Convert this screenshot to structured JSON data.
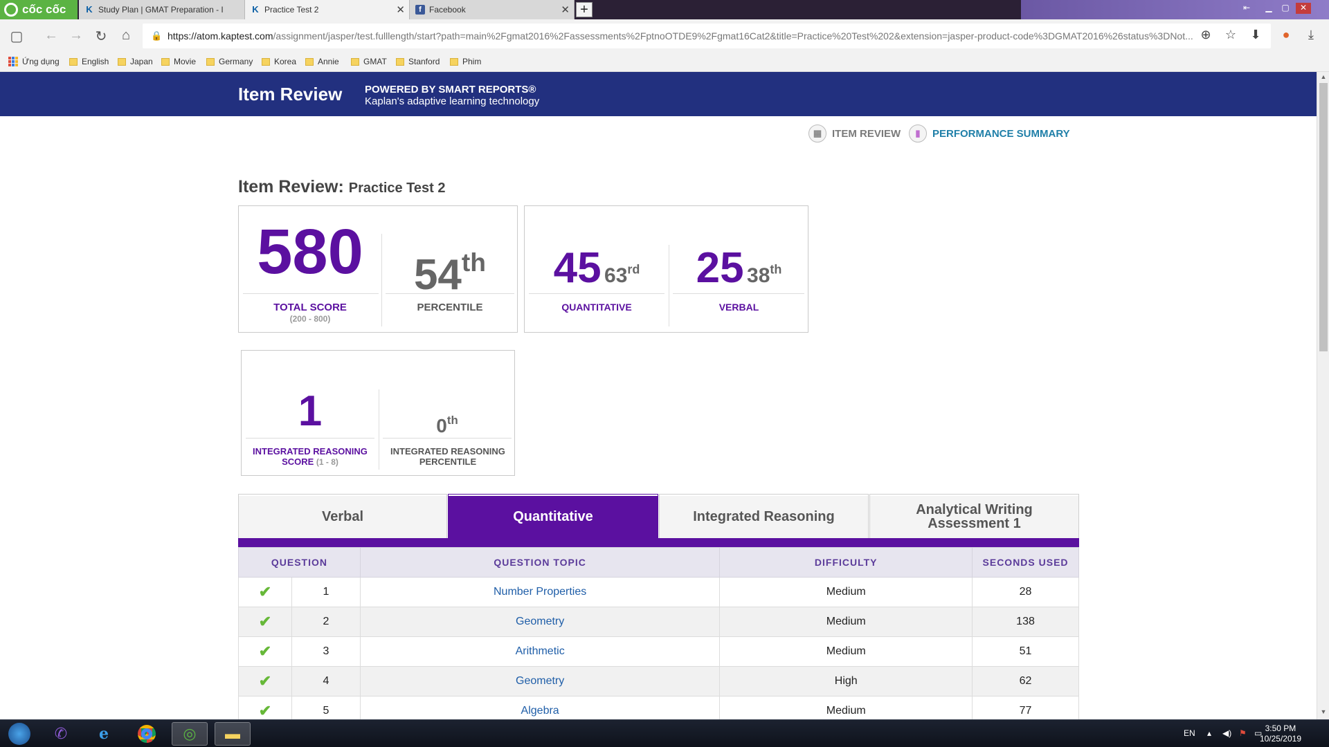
{
  "browser": {
    "brand": "cốc cốc",
    "tabs": [
      {
        "title": "Study Plan | GMAT Preparation - I",
        "icon": "kaplan-k-icon"
      },
      {
        "title": "Practice Test 2",
        "icon": "kaplan-k-icon"
      },
      {
        "title": "Facebook",
        "icon": "facebook-icon"
      }
    ],
    "url_host": "https://atom.kaptest.com",
    "url_path": "/assignment/jasper/test.fulllength/start?path=main%2Fgmat2016%2Fassessments%2FptnoOTDE9%2Fgmat16Cat2&title=Practice%20Test%202&extension=jasper-product-code%3DGMAT2016%26status%3DNot...",
    "bookmarks": [
      "Ứng dụng",
      "English",
      "Japan",
      "Movie",
      "Germany",
      "Korea",
      "Annie",
      "GMAT",
      "Stanford",
      "Phim"
    ]
  },
  "header": {
    "title": "Item Review",
    "powered_by": "POWERED BY SMART REPORTS®",
    "tagline": "Kaplan's adaptive learning technology"
  },
  "view_links": {
    "item_review": "ITEM REVIEW",
    "performance_summary": "PERFORMANCE SUMMARY"
  },
  "review": {
    "label": "Item Review:",
    "test_name": "Practice Test 2"
  },
  "scores": {
    "total": "580",
    "total_label": "TOTAL SCORE",
    "total_range": "(200 - 800)",
    "percentile_num": "54",
    "percentile_suffix": "th",
    "percentile_label": "PERCENTILE",
    "quant_score": "45",
    "quant_pct_num": "63",
    "quant_pct_suffix": "rd",
    "quant_label": "QUANTITATIVE",
    "verbal_score": "25",
    "verbal_pct_num": "38",
    "verbal_pct_suffix": "th",
    "verbal_label": "VERBAL",
    "ir_score": "1",
    "ir_label": "INTEGRATED REASONING SCORE",
    "ir_range": "(1 - 8)",
    "ir_pct_num": "0",
    "ir_pct_suffix": "th",
    "ir_pct_label": "INTEGRATED REASONING PERCENTILE"
  },
  "section_tabs": [
    {
      "label": "Verbal",
      "active": false
    },
    {
      "label": "Quantitative",
      "active": true
    },
    {
      "label": "Integrated Reasoning",
      "active": false
    },
    {
      "label": "Analytical Writing Assessment 1",
      "active": false
    }
  ],
  "table": {
    "headers": [
      "QUESTION",
      "QUESTION TOPIC",
      "DIFFICULTY",
      "SECONDS USED"
    ],
    "rows": [
      {
        "status": "correct",
        "num": "1",
        "topic": "Number Properties",
        "difficulty": "Medium",
        "seconds": "28"
      },
      {
        "status": "correct",
        "num": "2",
        "topic": "Geometry",
        "difficulty": "Medium",
        "seconds": "138"
      },
      {
        "status": "correct",
        "num": "3",
        "topic": "Arithmetic",
        "difficulty": "Medium",
        "seconds": "51"
      },
      {
        "status": "correct",
        "num": "4",
        "topic": "Geometry",
        "difficulty": "High",
        "seconds": "62"
      },
      {
        "status": "correct",
        "num": "5",
        "topic": "Algebra",
        "difficulty": "Medium",
        "seconds": "77"
      }
    ]
  },
  "taskbar": {
    "lang": "EN",
    "time": "3:50 PM",
    "date": "10/25/2019"
  },
  "colors": {
    "brand_purple": "#5b10a0",
    "header_navy": "#22307f",
    "check_green": "#66b838",
    "link_blue": "#1f5ea8"
  }
}
